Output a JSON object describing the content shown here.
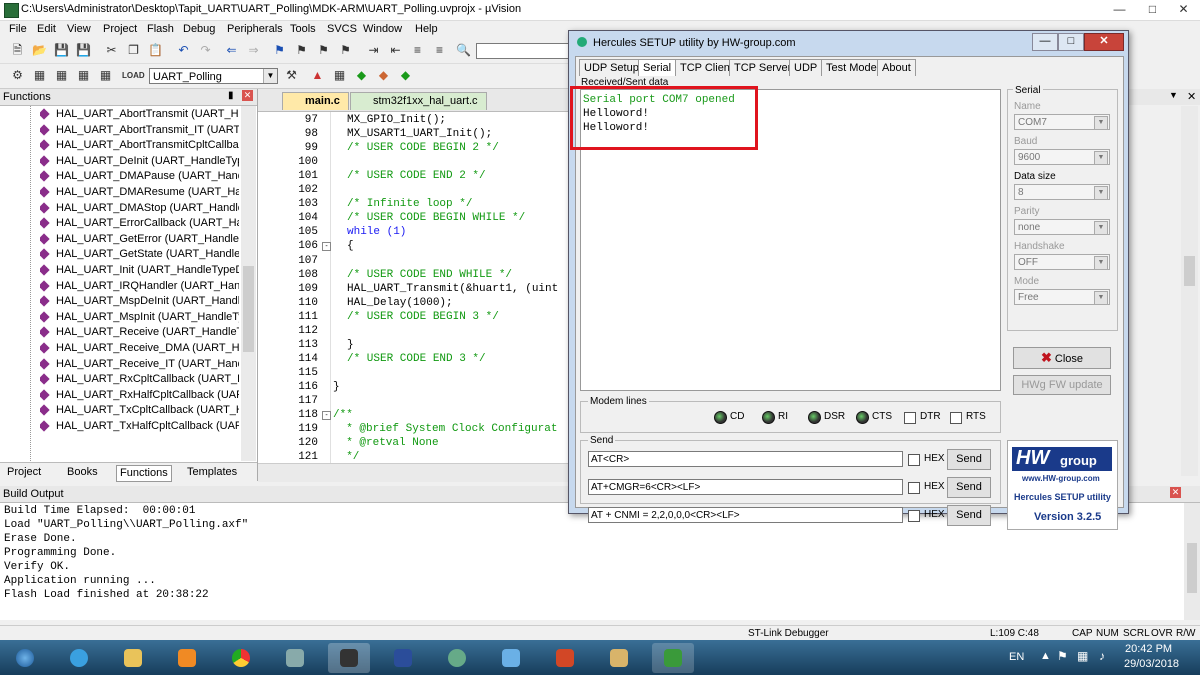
{
  "window": {
    "title": "C:\\Users\\Administrator\\Desktop\\Tapit_UART\\UART_Polling\\MDK-ARM\\UART_Polling.uvprojx - µVision"
  },
  "menu": [
    "File",
    "Edit",
    "View",
    "Project",
    "Flash",
    "Debug",
    "Peripherals",
    "Tools",
    "SVCS",
    "Window",
    "Help"
  ],
  "toolbar": {
    "target": "UART_Polling"
  },
  "functions_pane": {
    "title": "Functions",
    "items": [
      "HAL_UART_AbortTransmit (UART_Har",
      "HAL_UART_AbortTransmit_IT (UART_H",
      "HAL_UART_AbortTransmitCpltCallbac",
      "HAL_UART_DeInit (UART_HandleType",
      "HAL_UART_DMAPause (UART_Handle",
      "HAL_UART_DMAResume (UART_Hand",
      "HAL_UART_DMAStop (UART_HandleT",
      "HAL_UART_ErrorCallback (UART_Hand",
      "HAL_UART_GetError (UART_HandleTyp",
      "HAL_UART_GetState (UART_HandleTy",
      "HAL_UART_Init (UART_HandleTypeDe",
      "HAL_UART_IRQHandler (UART_Handle",
      "HAL_UART_MspDeInit (UART_HandleT",
      "HAL_UART_MspInit (UART_HandleTyp",
      "HAL_UART_Receive (UART_HandleTyp",
      "HAL_UART_Receive_DMA (UART_Han",
      "HAL_UART_Receive_IT (UART_HandleT",
      "HAL_UART_RxCpltCallback (UART_Ha",
      "HAL_UART_RxHalfCpltCallback (UART",
      "HAL_UART_TxCpltCallback (UART_Ha",
      "HAL_UART_TxHalfCpltCallback (UART"
    ],
    "tabs": [
      "Project",
      "Books",
      "Functions",
      "Templates"
    ]
  },
  "editor": {
    "tabs": [
      "main.c",
      "stm32f1xx_hal_uart.c"
    ],
    "lines": [
      {
        "n": "97",
        "t": "MX_GPIO_Init();",
        "c": "code"
      },
      {
        "n": "98",
        "t": "MX_USART1_UART_Init();",
        "c": "code"
      },
      {
        "n": "99",
        "t": "/* USER CODE BEGIN 2 */",
        "c": "cm"
      },
      {
        "n": "100",
        "t": "",
        "c": "code"
      },
      {
        "n": "101",
        "t": "/* USER CODE END 2 */",
        "c": "cm"
      },
      {
        "n": "102",
        "t": "",
        "c": "code"
      },
      {
        "n": "103",
        "t": "/* Infinite loop */",
        "c": "cm"
      },
      {
        "n": "104",
        "t": "/* USER CODE BEGIN WHILE */",
        "c": "cm"
      },
      {
        "n": "105",
        "t": "while (1)",
        "c": "kw"
      },
      {
        "n": "106",
        "t": "{",
        "c": "code"
      },
      {
        "n": "107",
        "t": "",
        "c": "code"
      },
      {
        "n": "108",
        "t": "/* USER CODE END WHILE */",
        "c": "cm"
      },
      {
        "n": "109",
        "t": "HAL_UART_Transmit(&huart1, (uint",
        "c": "code"
      },
      {
        "n": "110",
        "t": "HAL_Delay(1000);",
        "c": "code"
      },
      {
        "n": "111",
        "t": "/* USER CODE BEGIN 3 */",
        "c": "cm"
      },
      {
        "n": "112",
        "t": "",
        "c": "code"
      },
      {
        "n": "113",
        "t": "}",
        "c": "code"
      },
      {
        "n": "114",
        "t": "/* USER CODE END 3 */",
        "c": "cm"
      },
      {
        "n": "115",
        "t": "",
        "c": "code"
      },
      {
        "n": "116",
        "t": "}",
        "c": "code"
      },
      {
        "n": "117",
        "t": "",
        "c": "code"
      },
      {
        "n": "118",
        "t": "/**",
        "c": "cm"
      },
      {
        "n": "119",
        "t": "  * @brief System Clock Configurat",
        "c": "cm"
      },
      {
        "n": "120",
        "t": "  * @retval None",
        "c": "cm"
      },
      {
        "n": "121",
        "t": "  */",
        "c": "cm"
      }
    ]
  },
  "build_output": {
    "title": "Build Output",
    "lines": [
      "Build Time Elapsed:  00:00:01",
      "Load \"UART_Polling\\\\UART_Polling.axf\"",
      "Erase Done.",
      "Programming Done.",
      "Verify OK.",
      "Application running ...",
      "Flash Load finished at 20:38:22"
    ]
  },
  "statusbar": {
    "debugger": "ST-Link Debugger",
    "position": "L:109 C:48",
    "flags": [
      "CAP",
      "NUM",
      "SCRL",
      "OVR",
      "R/W"
    ]
  },
  "hercules": {
    "title": "Hercules SETUP utility by HW-group.com",
    "tabs": [
      "UDP Setup",
      "Serial",
      "TCP Client",
      "TCP Server",
      "UDP",
      "Test Mode",
      "About"
    ],
    "received_label": "Received/Sent data",
    "received_lines": [
      "Serial port COM7 opened",
      "Helloword!",
      "Helloword!"
    ],
    "serial": {
      "group_label": "Serial",
      "name_label": "Name",
      "name": "COM7",
      "baud_label": "Baud",
      "baud": "9600",
      "datasize_label": "Data size",
      "datasize": "8",
      "parity_label": "Parity",
      "parity": "none",
      "handshake_label": "Handshake",
      "handshake": "OFF",
      "mode_label": "Mode",
      "mode": "Free"
    },
    "close_label": "Close",
    "hwg_update_label": "HWg FW update",
    "modem_label": "Modem lines",
    "modem": [
      "CD",
      "RI",
      "DSR",
      "CTS",
      "DTR",
      "RTS"
    ],
    "send_label": "Send",
    "send_rows": [
      "AT<CR>",
      "AT+CMGR=6<CR><LF>",
      "AT + CNMI  = 2,2,0,0,0<CR><LF>"
    ],
    "hex_label": "HEX",
    "send_button": "Send",
    "logo_text": "HW",
    "logo_group": "group",
    "logo_url": "www.HW-group.com",
    "utility_label": "Hercules SETUP utility",
    "version": "Version  3.2.5"
  },
  "taskbar": {
    "lang": "EN",
    "time": "20:42 PM",
    "date": "29/03/2018"
  }
}
